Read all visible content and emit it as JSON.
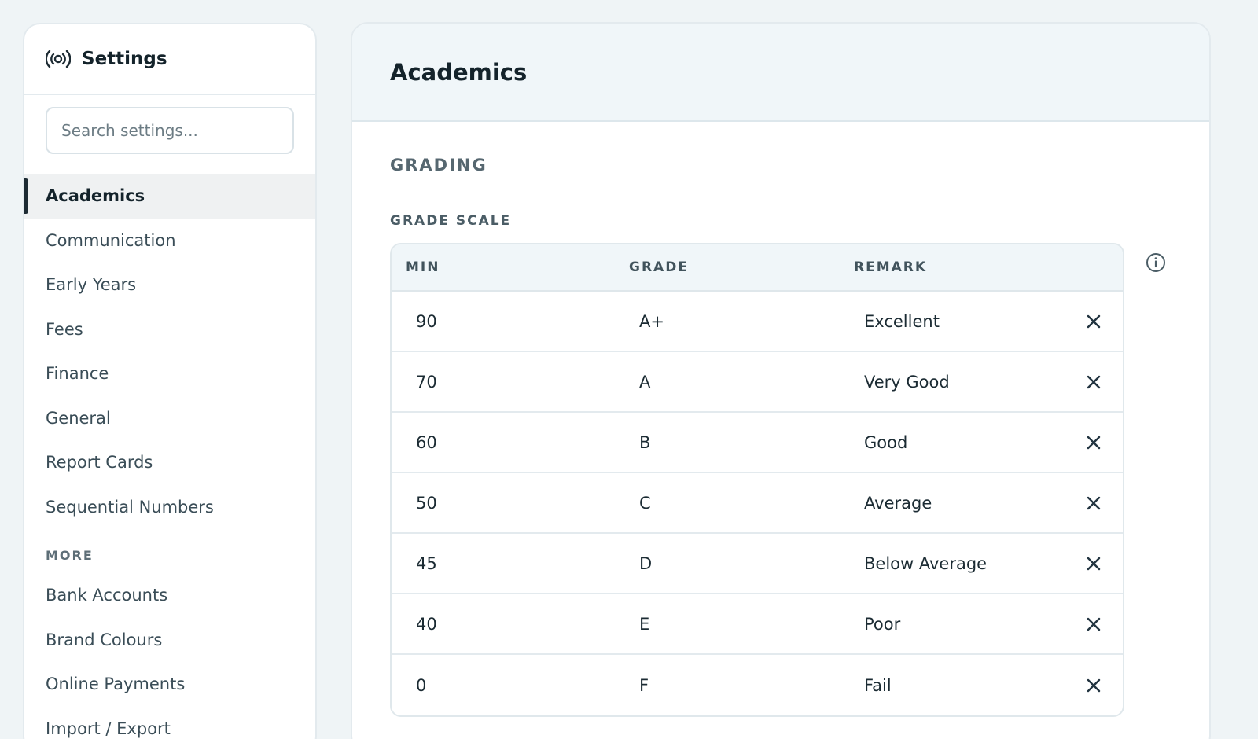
{
  "sidebar": {
    "title": "Settings",
    "search_placeholder": "Search settings...",
    "items": [
      {
        "label": "Academics"
      },
      {
        "label": "Communication"
      },
      {
        "label": "Early Years"
      },
      {
        "label": "Fees"
      },
      {
        "label": "Finance"
      },
      {
        "label": "General"
      },
      {
        "label": "Report Cards"
      },
      {
        "label": "Sequential Numbers"
      }
    ],
    "more_label": "MORE",
    "more_items": [
      {
        "label": "Bank Accounts"
      },
      {
        "label": "Brand Colours"
      },
      {
        "label": "Online Payments"
      },
      {
        "label": "Import / Export"
      }
    ],
    "active_item": "Academics"
  },
  "main": {
    "title": "Academics",
    "section_title": "GRADING",
    "sub_title": "GRADE SCALE",
    "table": {
      "headers": {
        "min": "MIN",
        "grade": "GRADE",
        "remark": "REMARK"
      },
      "rows": [
        {
          "min": "90",
          "grade": "A+",
          "remark": "Excellent"
        },
        {
          "min": "70",
          "grade": "A",
          "remark": "Very Good"
        },
        {
          "min": "60",
          "grade": "B",
          "remark": "Good"
        },
        {
          "min": "50",
          "grade": "C",
          "remark": "Average"
        },
        {
          "min": "45",
          "grade": "D",
          "remark": "Below Average"
        },
        {
          "min": "40",
          "grade": "E",
          "remark": "Poor"
        },
        {
          "min": "0",
          "grade": "F",
          "remark": "Fail"
        }
      ]
    }
  },
  "colors": {
    "background": "#eff4f6",
    "panel": "#ffffff",
    "header_bg": "#f0f6f9",
    "active_bg": "#eff1f2",
    "accent": "#1d2b33",
    "text": "#223440"
  },
  "icons": {
    "settings": "broadcast-icon",
    "info": "info-icon",
    "remove": "close-icon"
  }
}
